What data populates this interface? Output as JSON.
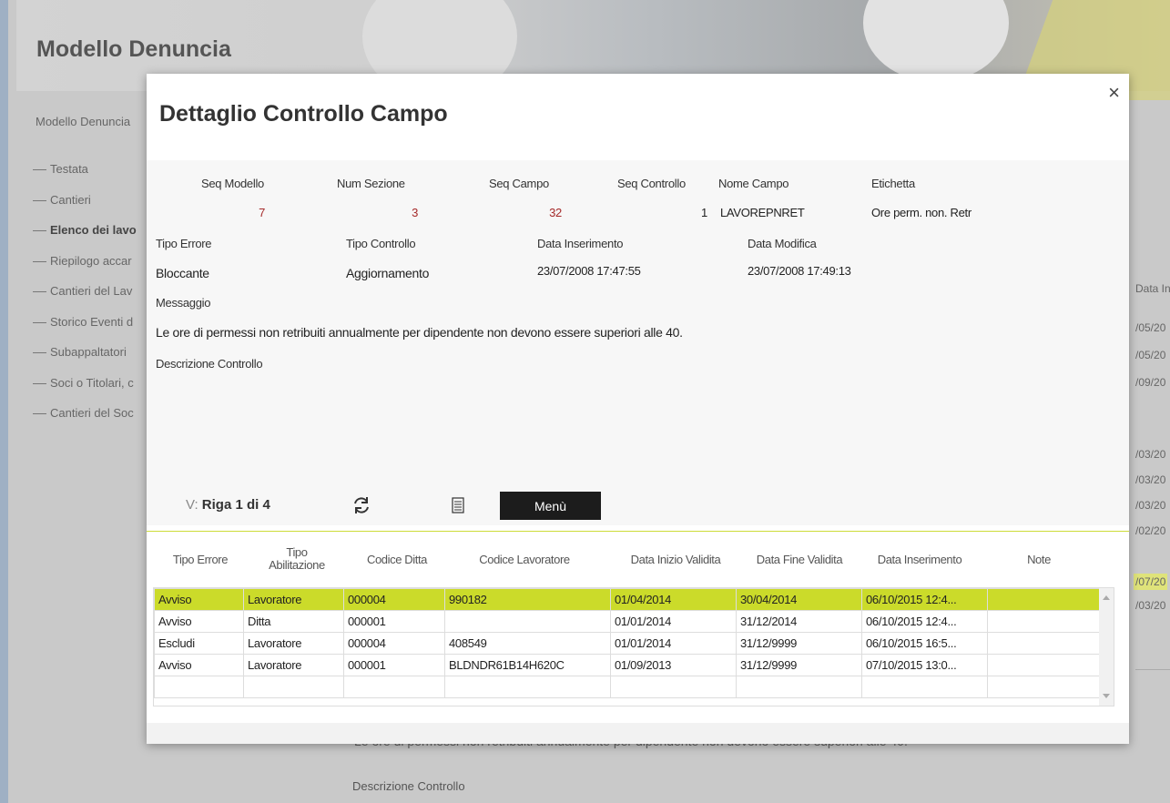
{
  "background": {
    "title": "Modello Denuncia",
    "subtitle": "Modello Denuncia",
    "nav": [
      "Testata",
      "Cantieri",
      "Elenco dei lavo",
      "Riepilogo accar",
      "Cantieri del Lav",
      "Storico Eventi d",
      "Subappaltatori",
      "Soci o Titolari, c",
      "Cantieri del Soc"
    ],
    "right_col": [
      "Data In",
      "/05/20",
      "/05/20",
      "/09/20",
      "/03/20",
      "/03/20",
      "/03/20",
      "/02/20",
      "/07/20",
      "/03/20"
    ],
    "bottom_text": "Le ore di permessi non retribuiti annualmente per dipendente non devono essere superiori alle 40.",
    "bottom_label": "Descrizione Controllo"
  },
  "modal": {
    "title": "Dettaglio Controllo Campo",
    "close_icon": "×",
    "fields": {
      "seq_modello_label": "Seq Modello",
      "seq_modello": "7",
      "num_sezione_label": "Num Sezione",
      "num_sezione": "3",
      "seq_campo_label": "Seq Campo",
      "seq_campo": "32",
      "seq_controllo_label": "Seq Controllo",
      "seq_controllo": "1",
      "nome_campo_label": "Nome Campo",
      "nome_campo": "LAVOREPNRET",
      "etichetta_label": "Etichetta",
      "etichetta": "Ore perm. non. Retr",
      "tipo_errore_label": "Tipo Errore",
      "tipo_errore": "Bloccante",
      "tipo_controllo_label": "Tipo Controllo",
      "tipo_controllo": "Aggiornamento",
      "data_inserimento_label": "Data Inserimento",
      "data_inserimento": "23/07/2008 17:47:55",
      "data_modifica_label": "Data Modifica",
      "data_modifica": "23/07/2008 17:49:13",
      "messaggio_label": "Messaggio",
      "messaggio": "Le ore di permessi non retribuiti annualmente per dipendente non devono essere superiori alle 40.",
      "descrizione_label": "Descrizione Controllo"
    },
    "toolbar": {
      "pager_prefix": "V:",
      "pager_text": "Riga 1 di 4",
      "menu_label": "Menù"
    },
    "grid": {
      "headers": {
        "tipo_errore": "Tipo Errore",
        "tipo_abil_1": "Tipo",
        "tipo_abil_2": "Abilitazione",
        "codice_ditta": "Codice Ditta",
        "codice_lavoratore": "Codice Lavoratore",
        "data_inizio": "Data Inizio Validita",
        "data_fine": "Data Fine Validita",
        "data_inserimento": "Data Inserimento",
        "note": "Note"
      },
      "rows": [
        [
          "Avviso",
          "Lavoratore",
          "000004",
          "990182",
          "01/04/2014",
          "30/04/2014",
          "06/10/2015 12:4...",
          ""
        ],
        [
          "Avviso",
          "Ditta",
          "000001",
          "",
          "01/01/2014",
          "31/12/2014",
          "06/10/2015 12:4...",
          ""
        ],
        [
          "Escludi",
          "Lavoratore",
          "000004",
          "408549",
          "01/01/2014",
          "31/12/9999",
          "06/10/2015 16:5...",
          ""
        ],
        [
          "Avviso",
          "Lavoratore",
          "000001",
          "BLDNDR61B14H620C",
          "01/09/2013",
          "31/12/9999",
          "07/10/2015 13:0...",
          ""
        ]
      ]
    }
  },
  "colors": {
    "selected_row": "#cbdb2a",
    "separator": "#cddc39",
    "number": "#a52a2a",
    "menu_bg": "#1c1c1c"
  }
}
